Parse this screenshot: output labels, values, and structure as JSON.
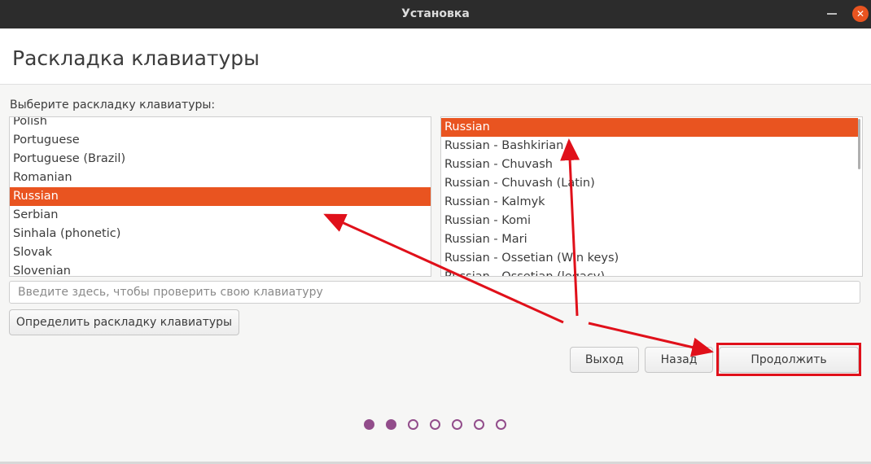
{
  "window": {
    "title": "Установка"
  },
  "page": {
    "title": "Раскладка клавиатуры",
    "prompt": "Выберите раскладку клавиатуры:"
  },
  "layouts": [
    "Polish",
    "Portuguese",
    "Portuguese (Brazil)",
    "Romanian",
    "Russian",
    "Serbian",
    "Sinhala (phonetic)",
    "Slovak",
    "Slovenian"
  ],
  "selected_layout": "Russian",
  "variants": [
    "Russian",
    "Russian - Bashkirian",
    "Russian - Chuvash",
    "Russian - Chuvash (Latin)",
    "Russian - Kalmyk",
    "Russian - Komi",
    "Russian - Mari",
    "Russian - Ossetian (Win keys)",
    "Russian - Ossetian (legacy)"
  ],
  "selected_variant": "Russian",
  "test_field": {
    "placeholder": "Введите здесь, чтобы проверить свою клавиатуру"
  },
  "buttons": {
    "detect": "Определить раскладку клавиатуры",
    "quit": "Выход",
    "back": "Назад",
    "continue": "Продолжить"
  },
  "progress": {
    "total_steps": 7,
    "completed_steps": 2
  },
  "colors": {
    "accent": "#e95420",
    "progress": "#924d8b",
    "annotation": "#e0101a"
  },
  "icons": {
    "close": "close-icon",
    "minimize": "minimize-icon"
  }
}
